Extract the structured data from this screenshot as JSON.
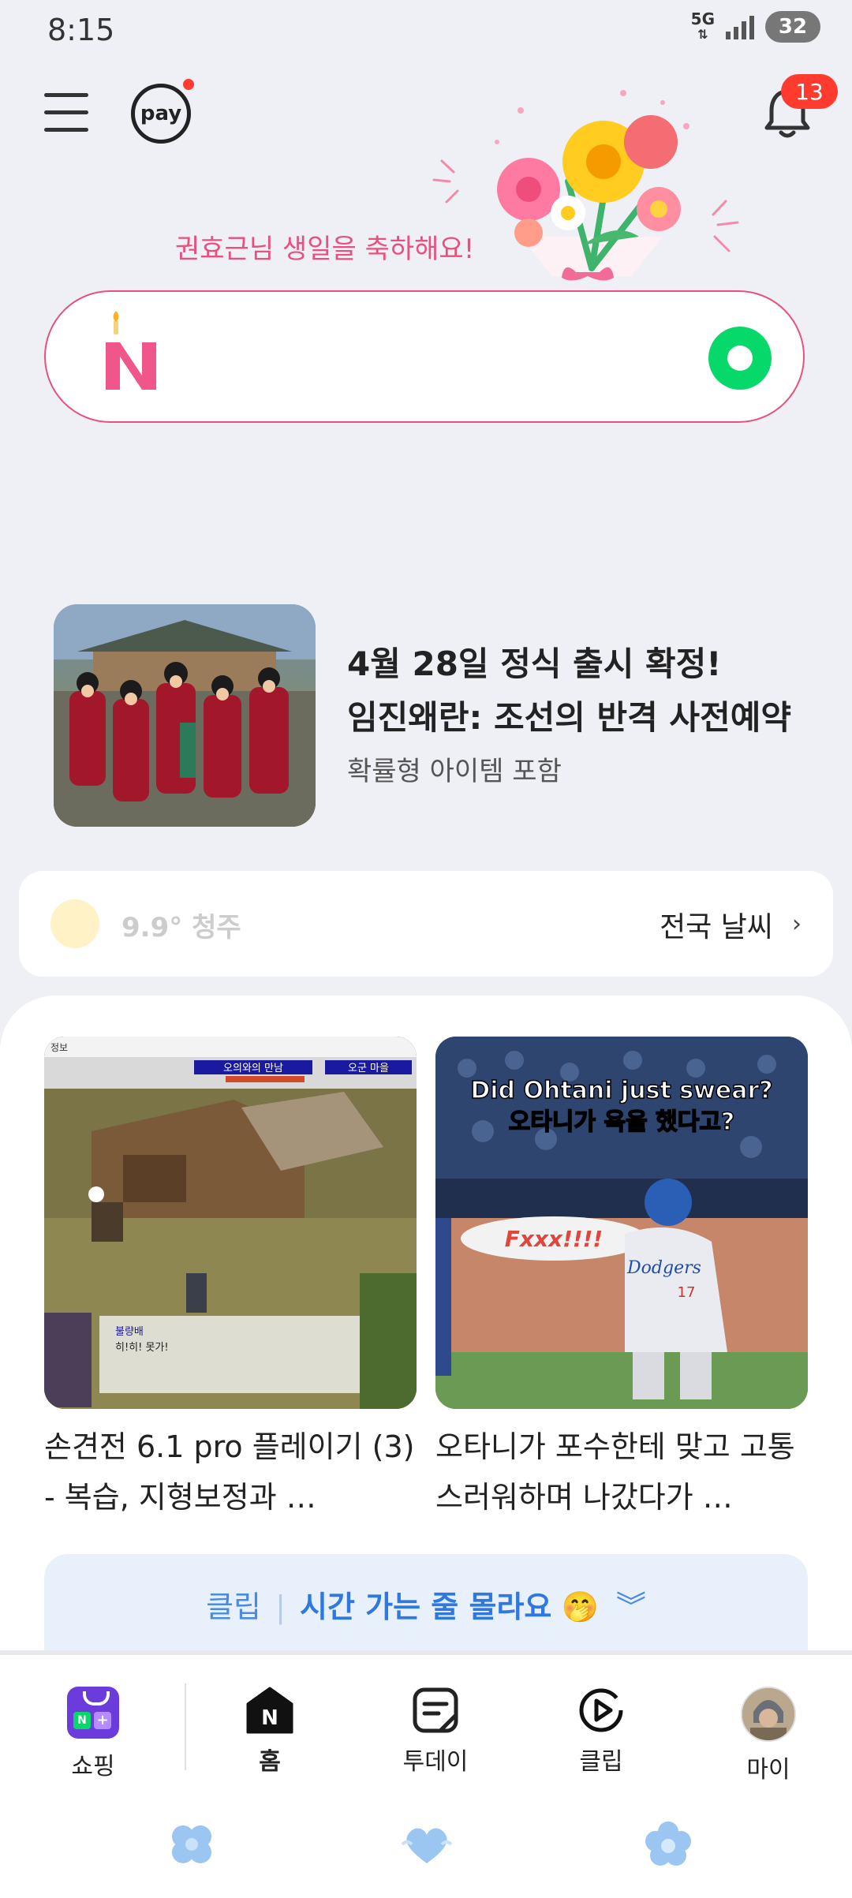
{
  "status_bar": {
    "time": "8:15",
    "network": "5G",
    "battery": "32"
  },
  "header": {
    "pay_label": "pay",
    "notification_count": "13",
    "birthday_message": "권효근님 생일을 축하해요!"
  },
  "search": {
    "logo_letter": "N",
    "accent": "#e8507d",
    "green": "#06d96a"
  },
  "ad": {
    "title_line1": "4월 28일 정식 출시 확정!",
    "title_line2": "임진왜란: 조선의 반격 사전예약",
    "subtitle": "확률형 아이템 포함"
  },
  "weather": {
    "temp_city": "9.9° 청주",
    "link": "전국 날씨"
  },
  "feed": {
    "cards": [
      {
        "title": "손견전 6.1 pro 플레이기 (3) - 복습, 지형보정과 …",
        "game_hud_1": "오의와의 만남",
        "game_hud_2": "오군 마을",
        "game_speaker": "불량배",
        "game_dialogue": "히!히! 못가!",
        "game_menu": "정보"
      },
      {
        "title": "오타니가 포수한테 맞고 고통스러워하며 나갔다가 …",
        "caption_en": "Did Ohtani just swear?",
        "caption_ko": "오타니가 욕을 했다고?",
        "bubble": "Fxxx!!!!",
        "jersey": "Dodgers",
        "jersey_number": "17"
      }
    ]
  },
  "clip_banner": {
    "prefix": "클립",
    "text": "시간 가는 줄 몰라요",
    "emoji": "🤭"
  },
  "bottom_nav": {
    "items": [
      {
        "label": "쇼핑",
        "icon": "shopping-icon"
      },
      {
        "label": "홈",
        "icon": "home-icon"
      },
      {
        "label": "투데이",
        "icon": "today-icon"
      },
      {
        "label": "클립",
        "icon": "clip-icon"
      },
      {
        "label": "마이",
        "icon": "profile-avatar"
      }
    ]
  }
}
